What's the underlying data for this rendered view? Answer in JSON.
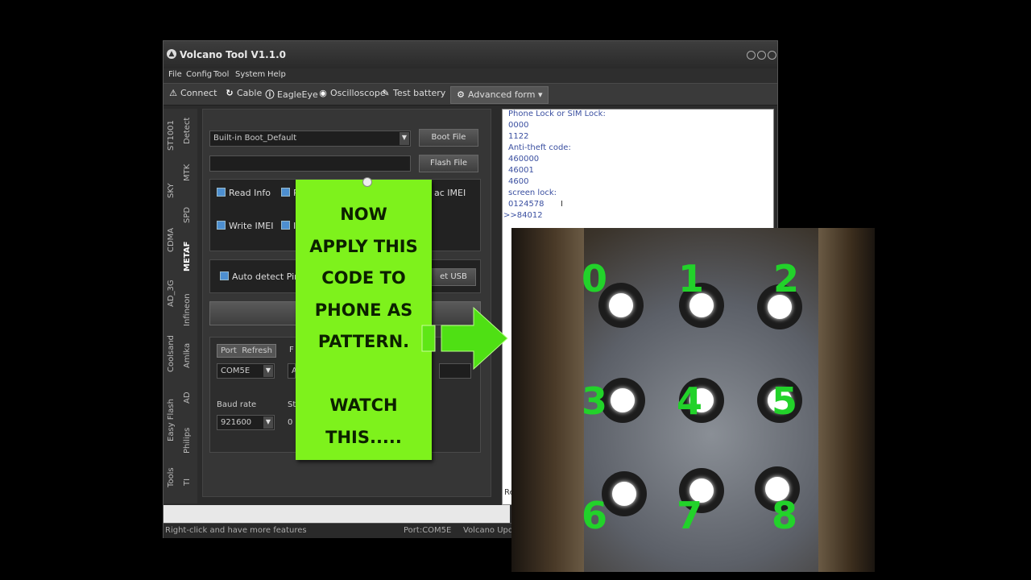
{
  "window": {
    "title": "Volcano Tool V1.1.0",
    "logo_icon": "volcano-logo-icon"
  },
  "menu": [
    "File",
    "Config",
    "Tool",
    "System",
    "Help"
  ],
  "toolbar": [
    {
      "label": "Connect",
      "icon": "warning-icon"
    },
    {
      "label": "Cable",
      "icon": "refresh-icon"
    },
    {
      "label": "EagleEye",
      "icon": "info-icon"
    },
    {
      "label": "Oscilloscope",
      "icon": "oscilloscope-icon"
    },
    {
      "label": "Test battery",
      "icon": "wrench-icon"
    },
    {
      "label": "Advanced form",
      "icon": "gear-icon"
    }
  ],
  "side_tabs_left": [
    "ST1001",
    "SKY",
    "CDMA",
    "AD_3G",
    "Coolsand",
    "Easy Flash",
    "Tools"
  ],
  "side_tabs_right": [
    "Detect",
    "MTK",
    "SPD",
    "METAF",
    "Infineon",
    "Amlka",
    "AD",
    "Philips",
    "TI"
  ],
  "panel": {
    "boot_combo": "Built-in Boot_Default",
    "boot_file_btn": "Boot File",
    "flash_file_btn": "Flash File",
    "read_info": "Read Info",
    "read_partial": "R",
    "mac_imei": "ac IMEI",
    "write_imei": "Write IMEI",
    "write_partial": "I",
    "auto_detect": "Auto detect Pino",
    "usb_btn": "et USB",
    "port_header": "Port",
    "refresh_header": "Refresh",
    "port_value": "COM5E",
    "f_partial": "F",
    "a_partial": "A",
    "baud_label": "Baud rate",
    "baud_value": "921600",
    "st_partial": "St",
    "zero_partial": "0"
  },
  "log": {
    "lines": [
      "Phone Lock or SIM Lock:",
      "0000",
      "1122",
      "Anti-theft code:",
      "460000",
      "46001",
      "4600",
      "screen lock:",
      "0124578",
      ">>84012"
    ],
    "footer_partial": "Re"
  },
  "status": {
    "hint": "Right-click and have more features",
    "port": "Port:COM5E",
    "app": "Volcano Upd"
  },
  "overlay_note": {
    "text": "NOW\nAPPLY THIS\nCODE TO\nPHONE AS\nPATTERN.\n\nWATCH\nTHIS....."
  },
  "pattern_numbers": [
    "0",
    "1",
    "2",
    "3",
    "4",
    "5",
    "6",
    "7",
    "8"
  ],
  "colors": {
    "note_green": "#7ef21c",
    "pattern_green": "#22d22a",
    "log_blue": "#3a4fa0"
  }
}
